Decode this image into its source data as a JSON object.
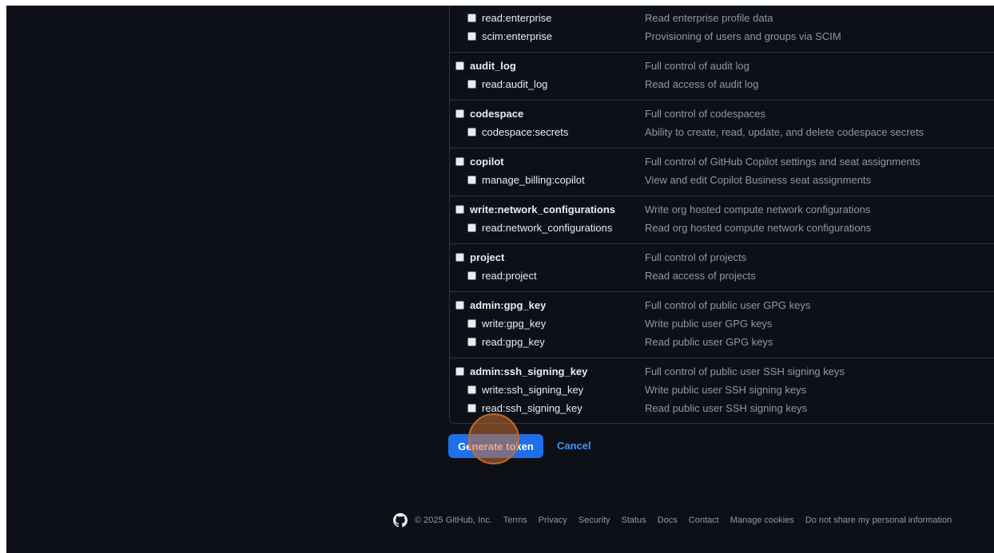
{
  "scopes": [
    {
      "partial": true,
      "rows": [
        {
          "name": "read:enterprise",
          "desc": "Read enterprise profile data",
          "level": "child"
        },
        {
          "name": "scim:enterprise",
          "desc": "Provisioning of users and groups via SCIM",
          "level": "child"
        }
      ]
    },
    {
      "rows": [
        {
          "name": "audit_log",
          "desc": "Full control of audit log",
          "level": "parent"
        },
        {
          "name": "read:audit_log",
          "desc": "Read access of audit log",
          "level": "child"
        }
      ]
    },
    {
      "rows": [
        {
          "name": "codespace",
          "desc": "Full control of codespaces",
          "level": "parent"
        },
        {
          "name": "codespace:secrets",
          "desc": "Ability to create, read, update, and delete codespace secrets",
          "level": "child"
        }
      ]
    },
    {
      "rows": [
        {
          "name": "copilot",
          "desc": "Full control of GitHub Copilot settings and seat assignments",
          "level": "parent"
        },
        {
          "name": "manage_billing:copilot",
          "desc": "View and edit Copilot Business seat assignments",
          "level": "child"
        }
      ]
    },
    {
      "rows": [
        {
          "name": "write:network_configurations",
          "desc": "Write org hosted compute network configurations",
          "level": "parent"
        },
        {
          "name": "read:network_configurations",
          "desc": "Read org hosted compute network configurations",
          "level": "child"
        }
      ]
    },
    {
      "rows": [
        {
          "name": "project",
          "desc": "Full control of projects",
          "level": "parent"
        },
        {
          "name": "read:project",
          "desc": "Read access of projects",
          "level": "child"
        }
      ]
    },
    {
      "rows": [
        {
          "name": "admin:gpg_key",
          "desc": "Full control of public user GPG keys",
          "level": "parent"
        },
        {
          "name": "write:gpg_key",
          "desc": "Write public user GPG keys",
          "level": "child"
        },
        {
          "name": "read:gpg_key",
          "desc": "Read public user GPG keys",
          "level": "child"
        }
      ]
    },
    {
      "rows": [
        {
          "name": "admin:ssh_signing_key",
          "desc": "Full control of public user SSH signing keys",
          "level": "parent"
        },
        {
          "name": "write:ssh_signing_key",
          "desc": "Write public user SSH signing keys",
          "level": "child"
        },
        {
          "name": "read:ssh_signing_key",
          "desc": "Read public user SSH signing keys",
          "level": "child"
        }
      ]
    }
  ],
  "actions": {
    "generate_label": "Generate token",
    "cancel_label": "Cancel"
  },
  "footer": {
    "logo_icon": "github-logo-icon",
    "copyright": "© 2025 GitHub, Inc.",
    "links": [
      "Terms",
      "Privacy",
      "Security",
      "Status",
      "Docs",
      "Contact",
      "Manage cookies",
      "Do not share my personal information"
    ]
  },
  "colors": {
    "background": "#0d1117",
    "border": "#30363d",
    "text_primary": "#e6edf3",
    "text_muted": "#9198a1",
    "button_blue": "#1f6feb",
    "link_blue": "#4493f8",
    "click_highlight": "#c06a2b"
  }
}
